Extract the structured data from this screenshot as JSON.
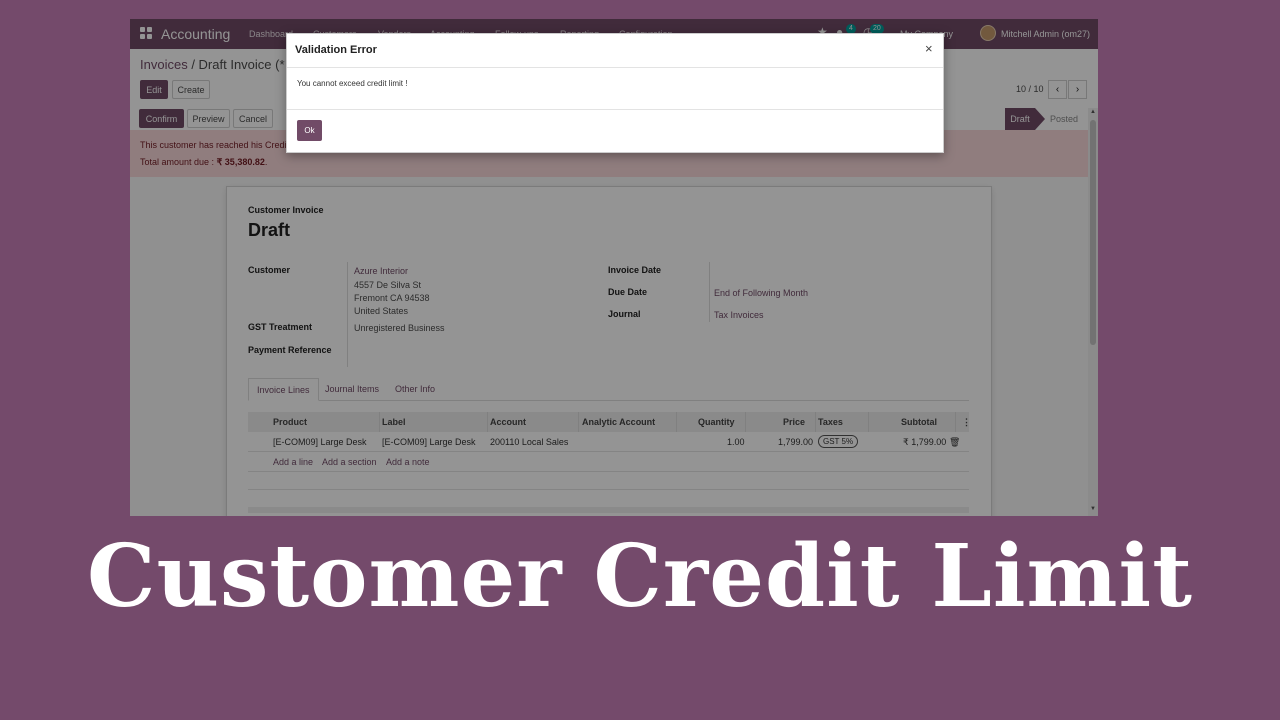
{
  "navbar": {
    "app_name": "Accounting",
    "menu": [
      "Dashboard",
      "Customers",
      "Vendors",
      "Accounting",
      "Follow-ups",
      "Reporting",
      "Configuration"
    ],
    "activity_count": "4",
    "message_count": "20",
    "company": "My Company",
    "user": "Mitchell Admin (om27)"
  },
  "breadcrumb": {
    "parent": "Invoices",
    "current": "Draft Invoice (* 48"
  },
  "toolbar": {
    "edit": "Edit",
    "create": "Create"
  },
  "pager": {
    "value": "10 / 10",
    "prev": "‹",
    "next": "›"
  },
  "actions": {
    "confirm": "Confirm",
    "preview": "Preview",
    "cancel": "Cancel"
  },
  "statusbar": {
    "current": "Draft",
    "next": "Posted"
  },
  "alert": {
    "line1": "This customer has reached his Credit",
    "line2_prefix": "Total amount due :",
    "amount": "₹ 35,380.82",
    "line2_suffix": "."
  },
  "form": {
    "doc_type": "Customer Invoice",
    "title": "Draft",
    "customer_label": "Customer",
    "customer_name": "Azure Interior",
    "address": [
      "4557 De Silva St",
      "Fremont CA 94538",
      "United States"
    ],
    "gst_label": "GST Treatment",
    "gst_value": "Unregistered Business",
    "payref_label": "Payment Reference",
    "invoice_date_label": "Invoice Date",
    "due_date_label": "Due Date",
    "due_date_value": "End of Following Month",
    "journal_label": "Journal",
    "journal_value": "Tax Invoices"
  },
  "tabs": [
    "Invoice Lines",
    "Journal Items",
    "Other Info"
  ],
  "lines": {
    "headers": [
      "Product",
      "Label",
      "Account",
      "Analytic Account",
      "Quantity",
      "Price",
      "Taxes",
      "Subtotal"
    ],
    "rows": [
      {
        "product": "[E-COM09] Large Desk",
        "label": "[E-COM09] Large Desk",
        "account": "200110 Local Sales",
        "analytic": "",
        "quantity": "1.00",
        "price": "1,799.00",
        "taxes": "GST 5%",
        "subtotal": "₹ 1,799.00"
      }
    ],
    "add_line": "Add a line",
    "add_section": "Add a section",
    "add_note": "Add a note"
  },
  "modal": {
    "title": "Validation Error",
    "close": "×",
    "message": "You cannot exceed credit limit !",
    "ok": "Ok"
  },
  "caption": "Customer Credit Limit",
  "colors": {
    "brand": "#714b67",
    "background": "#744a6b",
    "alert_bg": "#f8d7da",
    "alert_text": "#721c24"
  }
}
